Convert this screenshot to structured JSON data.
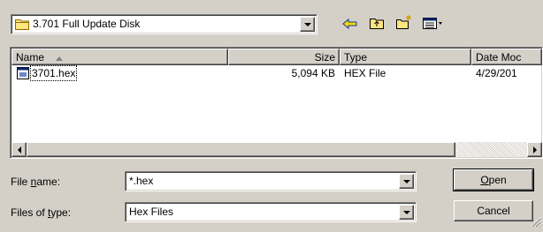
{
  "look_in": {
    "value": "3.701 Full Update Disk"
  },
  "toolbar": {
    "icons": [
      "back-arrow-icon",
      "up-folder-icon",
      "new-folder-icon",
      "view-menu-icon"
    ]
  },
  "file_list": {
    "columns": [
      {
        "label": "Name"
      },
      {
        "label": "Size"
      },
      {
        "label": "Type"
      },
      {
        "label": "Date Moc"
      }
    ],
    "rows": [
      {
        "name": "3701.hex",
        "size": "5,094 KB",
        "type": "HEX File",
        "date": "4/29/201"
      }
    ]
  },
  "file_name": {
    "label_pre": "File ",
    "label_u": "n",
    "label_post": "ame:",
    "value": "*.hex"
  },
  "file_type": {
    "label_pre": "Files of ",
    "label_u": "t",
    "label_post": "ype:",
    "value": "Hex Files"
  },
  "buttons": {
    "open_u": "O",
    "open_rest": "pen",
    "cancel": "Cancel"
  },
  "colors": {
    "face": "#d4d0c8",
    "selection": "#0a246a"
  }
}
